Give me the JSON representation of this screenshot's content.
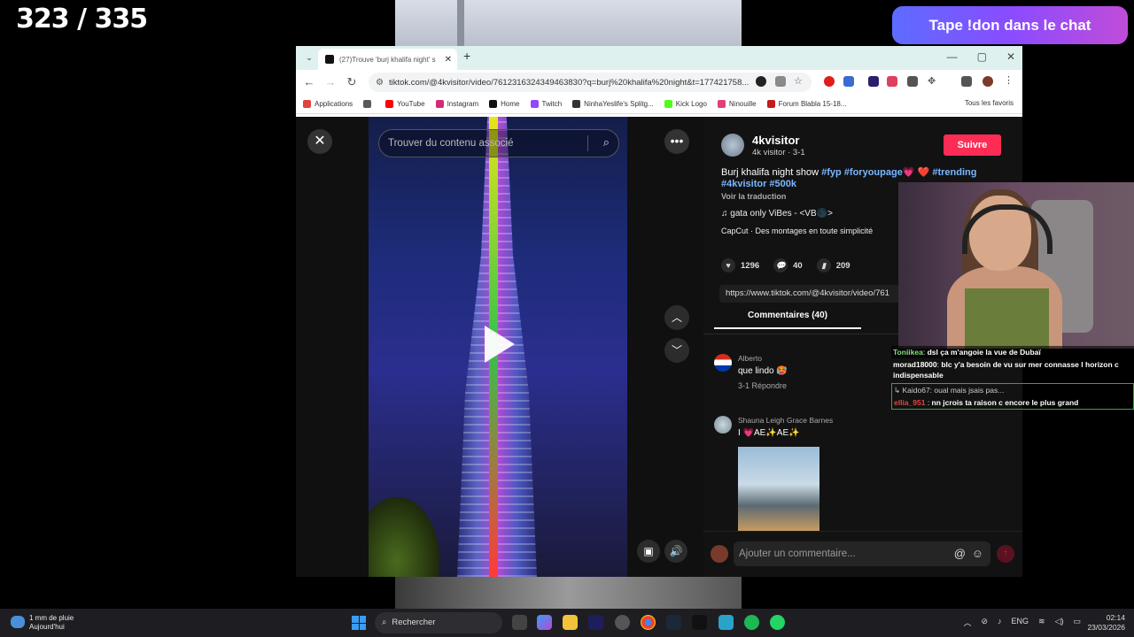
{
  "overlay": {
    "counter": "323 / 335",
    "donate_text": "Tape !don dans le chat"
  },
  "browser": {
    "tab_title": "(27)Trouve 'burj khalifa night' s",
    "tab_close": "✕",
    "new_tab": "+",
    "url": "tiktok.com/@4kvisitor/video/7612316324349463830?q=burj%20khalifa%20night&t=177421758...",
    "bookmarks": [
      {
        "label": "Applications",
        "color": "#e0443e"
      },
      {
        "label": "",
        "color": "#5a5a5a"
      },
      {
        "label": "YouTube",
        "color": "#ff0000"
      },
      {
        "label": "Instagram",
        "color": "#d62976"
      },
      {
        "label": "Home",
        "color": "#111111"
      },
      {
        "label": "Twitch",
        "color": "#9146ff"
      },
      {
        "label": "NinhaYeslife's Splitg...",
        "color": "#333333"
      },
      {
        "label": "Kick Logo",
        "color": "#53fc18"
      },
      {
        "label": "Ninouille",
        "color": "#e0407a"
      },
      {
        "label": "Forum Blabla 15-18...",
        "color": "#c21b1b"
      }
    ],
    "all_bookmarks": "Tous les favoris"
  },
  "tiktok": {
    "search_placeholder": "Trouver du contenu associé",
    "author": "4kvisitor",
    "author_sub": "4k visitor · 3-1",
    "follow_label": "Suivre",
    "desc_text": "Burj khalifa night show ",
    "desc_tags_1": "#fyp #foryoupage",
    "desc_heart": "💗 ❤️ ",
    "desc_tags_2": "#trending",
    "desc_tags_3": "#4kvisitor #500k",
    "translate": "Voir la traduction",
    "music": "♫  gata only ViBes - <VB🌑>",
    "capcut": "CapCut · Des montages en toute simplicité",
    "likes": "1296",
    "comments_count": "40",
    "saves": "209",
    "share_url": "https://www.tiktok.com/@4kvisitor/video/761",
    "comments_tab": "Commentaires (40)",
    "comments": [
      {
        "name": "Alberto",
        "text": "que lindo 🥵",
        "meta": "3-1     Répondre"
      },
      {
        "name": "Shauna Leigh Grace Barnes",
        "text": "I 💗AE✨AE✨",
        "meta": ""
      }
    ],
    "comment_placeholder": "Ajouter un commentaire...",
    "at_sign": "@",
    "emoji": "☺"
  },
  "chat": [
    {
      "user": "Toniikea",
      "msg": "dsl ça m'angoie la vue de Dubaï",
      "user_color": "#7ee07e"
    },
    {
      "user": "morad18000",
      "msg": "blc y'a besoin de vu sur mer connasse l horizon c indispensable",
      "user_color": "#e8e8e8"
    },
    {
      "user": "Kaido67:",
      "msg": "oual mais jsais pas...",
      "user_color": "#e8e8e8"
    },
    {
      "user": "ellia_951",
      "msg": "nn jcrois ta raison c encore le plus grand",
      "user_color": "#e04545"
    }
  ],
  "taskbar": {
    "weather_line1": "1 mm de pluie",
    "weather_line2": "Aujourd'hui",
    "search_label": "Rechercher",
    "lang": "ENG",
    "time": "02:14",
    "date": "23/03/2026"
  }
}
